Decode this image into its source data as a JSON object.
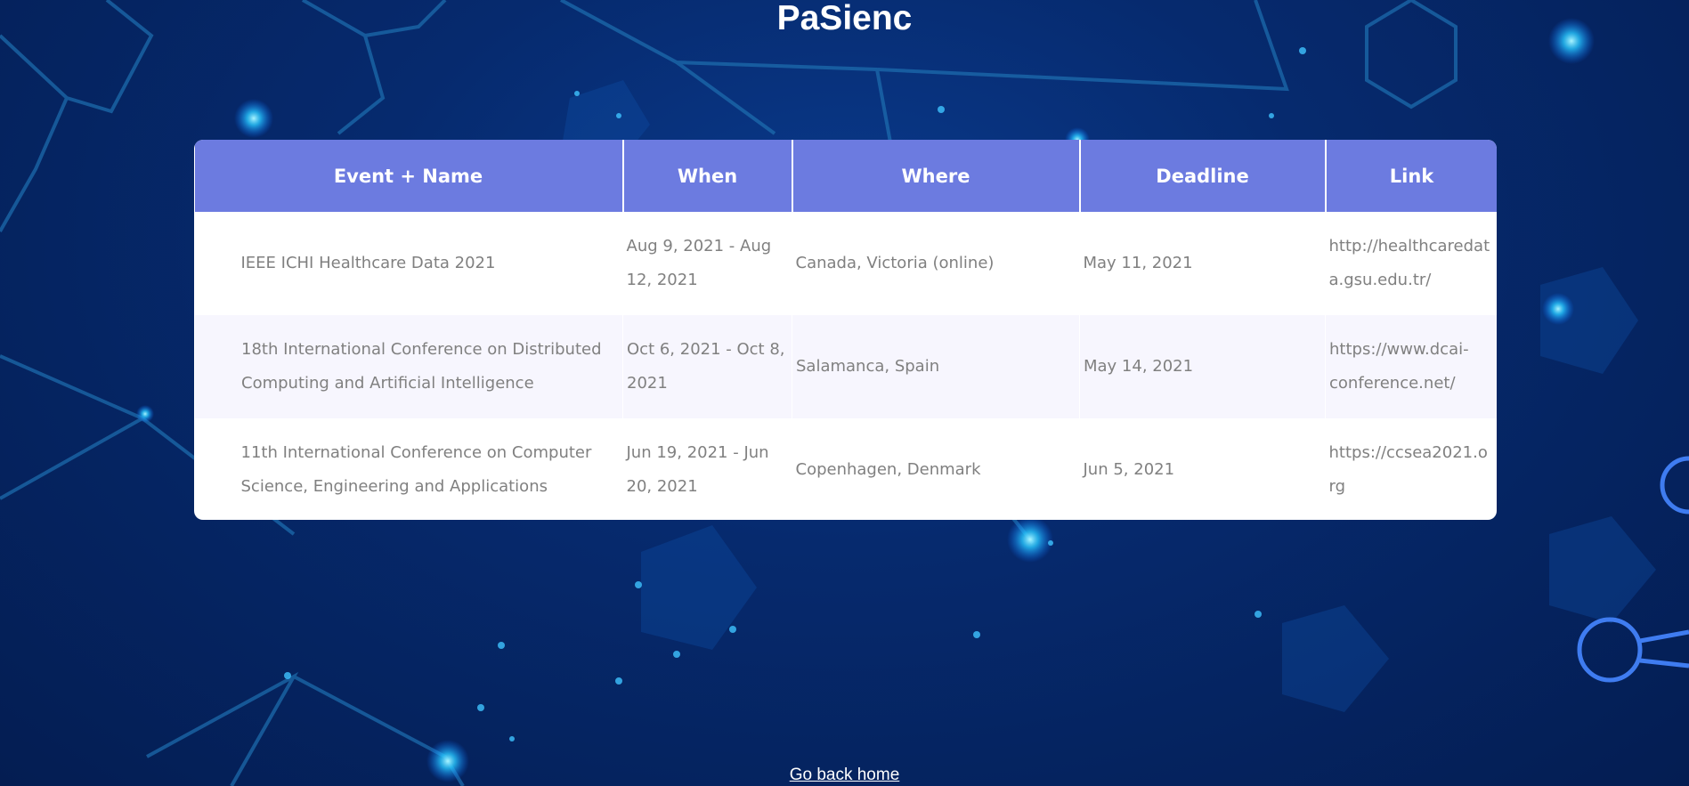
{
  "page": {
    "title": "PaSienc",
    "home_link": "Go back home"
  },
  "colors": {
    "header_bg": "#6c7be0",
    "page_bg": "#062a6e",
    "alt_row_bg": "#f7f6fe",
    "cell_text": "#808080"
  },
  "table": {
    "headers": [
      "Event + Name",
      "When",
      "Where",
      "Deadline",
      "Link"
    ],
    "rows": [
      {
        "event": "IEEE ICHI Healthcare Data 2021",
        "when": "Aug 9, 2021 - Aug 12, 2021",
        "where": "Canada, Victoria (online)",
        "deadline": "May 11, 2021",
        "link": "http://healthcaredata.gsu.edu.tr/"
      },
      {
        "event": "18th International Conference on Distributed Computing and Artificial Intelligence",
        "when": "Oct 6, 2021 - Oct 8, 2021",
        "where": "Salamanca, Spain",
        "deadline": "May 14, 2021",
        "link": "https://www.dcai-conference.net/"
      },
      {
        "event": "11th International Conference on Computer Science, Engineering and Applications",
        "when": "Jun 19, 2021 - Jun 20, 2021",
        "where": "Copenhagen, Denmark",
        "deadline": "Jun 5, 2021",
        "link": "https://ccsea2021.org"
      }
    ]
  }
}
